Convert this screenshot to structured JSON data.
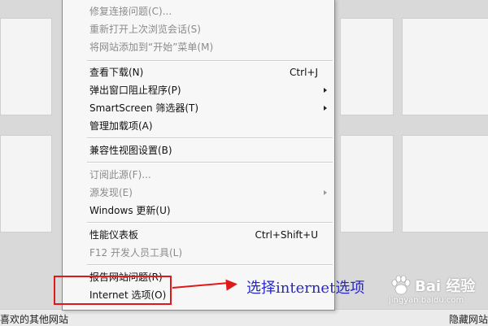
{
  "background": {
    "bottom_left_text": "喜欢的其他网站",
    "bottom_right_text": "隐藏网站"
  },
  "menu": {
    "items": [
      {
        "label": "修复连接问题(C)...",
        "disabled": true
      },
      {
        "label": "重新打开上次浏览会话(S)",
        "disabled": true
      },
      {
        "label": "将网站添加到“开始”菜单(M)",
        "disabled": true
      },
      {
        "label": "查看下载(N)",
        "shortcut": "Ctrl+J"
      },
      {
        "label": "弹出窗口阻止程序(P)",
        "submenu": true
      },
      {
        "label": "SmartScreen 筛选器(T)",
        "submenu": true
      },
      {
        "label": "管理加载项(A)"
      },
      {
        "label": "兼容性视图设置(B)"
      },
      {
        "label": "订阅此源(F)...",
        "disabled": true
      },
      {
        "label": "源发现(E)",
        "disabled": true,
        "submenu": true
      },
      {
        "label": "Windows 更新(U)"
      },
      {
        "label": "性能仪表板",
        "shortcut": "Ctrl+Shift+U"
      },
      {
        "label": "F12 开发人员工具(L)",
        "disabled": true
      },
      {
        "label": "报告网站问题(R)"
      },
      {
        "label": "Internet 选项(O)"
      }
    ]
  },
  "annotation": {
    "text": "选择internet选项",
    "color": "#2626c8",
    "highlight_color": "#e01818"
  },
  "watermark": {
    "brand": "Bai 经验",
    "url": "jingyan.baidu.com"
  }
}
